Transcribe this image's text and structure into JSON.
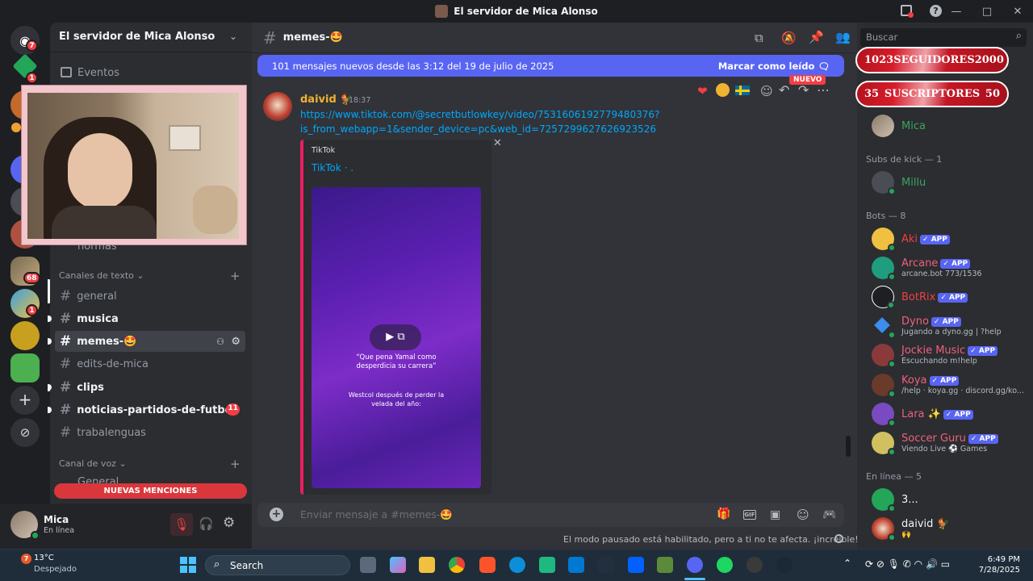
{
  "window": {
    "title": "El servidor de Mica Alonso",
    "controls": [
      "—",
      "□",
      "✕"
    ]
  },
  "rail": {
    "badges": [
      "7",
      "1",
      "68",
      "1"
    ]
  },
  "sidebar": {
    "server_name": "El servidor de Mica Alonso",
    "events_label": "Eventos",
    "partial_channel": "normas",
    "text_category": "Canales de texto",
    "channels": [
      {
        "name": "general",
        "state": "read"
      },
      {
        "name": "musica",
        "state": "unread"
      },
      {
        "name": "memes-🤩",
        "state": "active"
      },
      {
        "name": "edits-de-mica",
        "state": "read"
      },
      {
        "name": "clips",
        "state": "unread"
      },
      {
        "name": "noticias-partidos-de-futbol",
        "state": "unread",
        "badge": "11"
      },
      {
        "name": "trabalenguas",
        "state": "read"
      }
    ],
    "voice_category": "Canal de voz",
    "voice_partial": "General",
    "mentions_banner": "NUEVAS MENCIONES"
  },
  "user": {
    "name": "Mica",
    "status": "En línea"
  },
  "channel": {
    "name": "memes-🤩"
  },
  "new_messages": {
    "text": "101 mensajes nuevos desde las 3:12 del 19 de julio de 2025",
    "action": "Marcar como leído"
  },
  "message": {
    "author": "daivid 🐓",
    "time": "18:37",
    "link_line1": "https://www.tiktok.com/@secretbutlowkey/video/7531606192779480376?",
    "link_line2": "is_from_webapp=1&sender_device=pc&web_id=7257299627626923526",
    "new_tag": "NUEVO",
    "embed_provider": "TikTok",
    "embed_title": "TikTok · .",
    "video_caption1": "“Que pena Yamal como desperdicia su carrera”",
    "video_caption2": "Westcol después de perder la velada del año:",
    "close": "✕"
  },
  "composer": {
    "placeholder": "Enviar mensaje a #memes-🤩"
  },
  "footer_notice": "El modo pausado está habilitado, pero a ti no te afecta. ¡increíble!",
  "members": {
    "search_placeholder": "Buscar",
    "overlay1": {
      "left": "1023",
      "label": "SEGUIDORES",
      "right": "2000"
    },
    "overlay2": {
      "left": "35",
      "label": "SUSCRIPTORES",
      "right": "50"
    },
    "top_member": "Mica",
    "subs_header": "Subs de kick — 1",
    "subs": [
      {
        "name": "Millu"
      }
    ],
    "bots_header": "Bots — 8",
    "app_tag": "✓ APP",
    "bots": [
      {
        "name": "Aki",
        "activity": "",
        "color": "#f23f43"
      },
      {
        "name": "Arcane",
        "activity": "arcane.bot 773/1536",
        "color": "#f0607a"
      },
      {
        "name": "BotRix",
        "activity": "",
        "color": "#f23f43"
      },
      {
        "name": "Dyno",
        "activity": "Jugando a dyno.gg | ?help",
        "color": "#f0607a"
      },
      {
        "name": "Jockie Music",
        "activity": "Escuchando m!help",
        "color": "#f0607a"
      },
      {
        "name": "Koya",
        "activity": "/help · koya.gg · discord.gg/ko...",
        "color": "#f0607a"
      },
      {
        "name": "Lara ✨",
        "activity": "",
        "color": "#f0607a"
      },
      {
        "name": "Soccer Guru",
        "activity": "Viendo Live ⚽ Games",
        "color": "#f0607a"
      }
    ],
    "online_header": "En línea — 5",
    "online": [
      {
        "name": "3..."
      },
      {
        "name": "daivid 🐓",
        "activity": "🙌"
      }
    ]
  },
  "taskbar": {
    "weather_temp": "13°C",
    "weather_desc": "Despejado",
    "weather_badge": "7",
    "search_label": "Search",
    "time": "6:49 PM",
    "date": "7/28/2025"
  }
}
